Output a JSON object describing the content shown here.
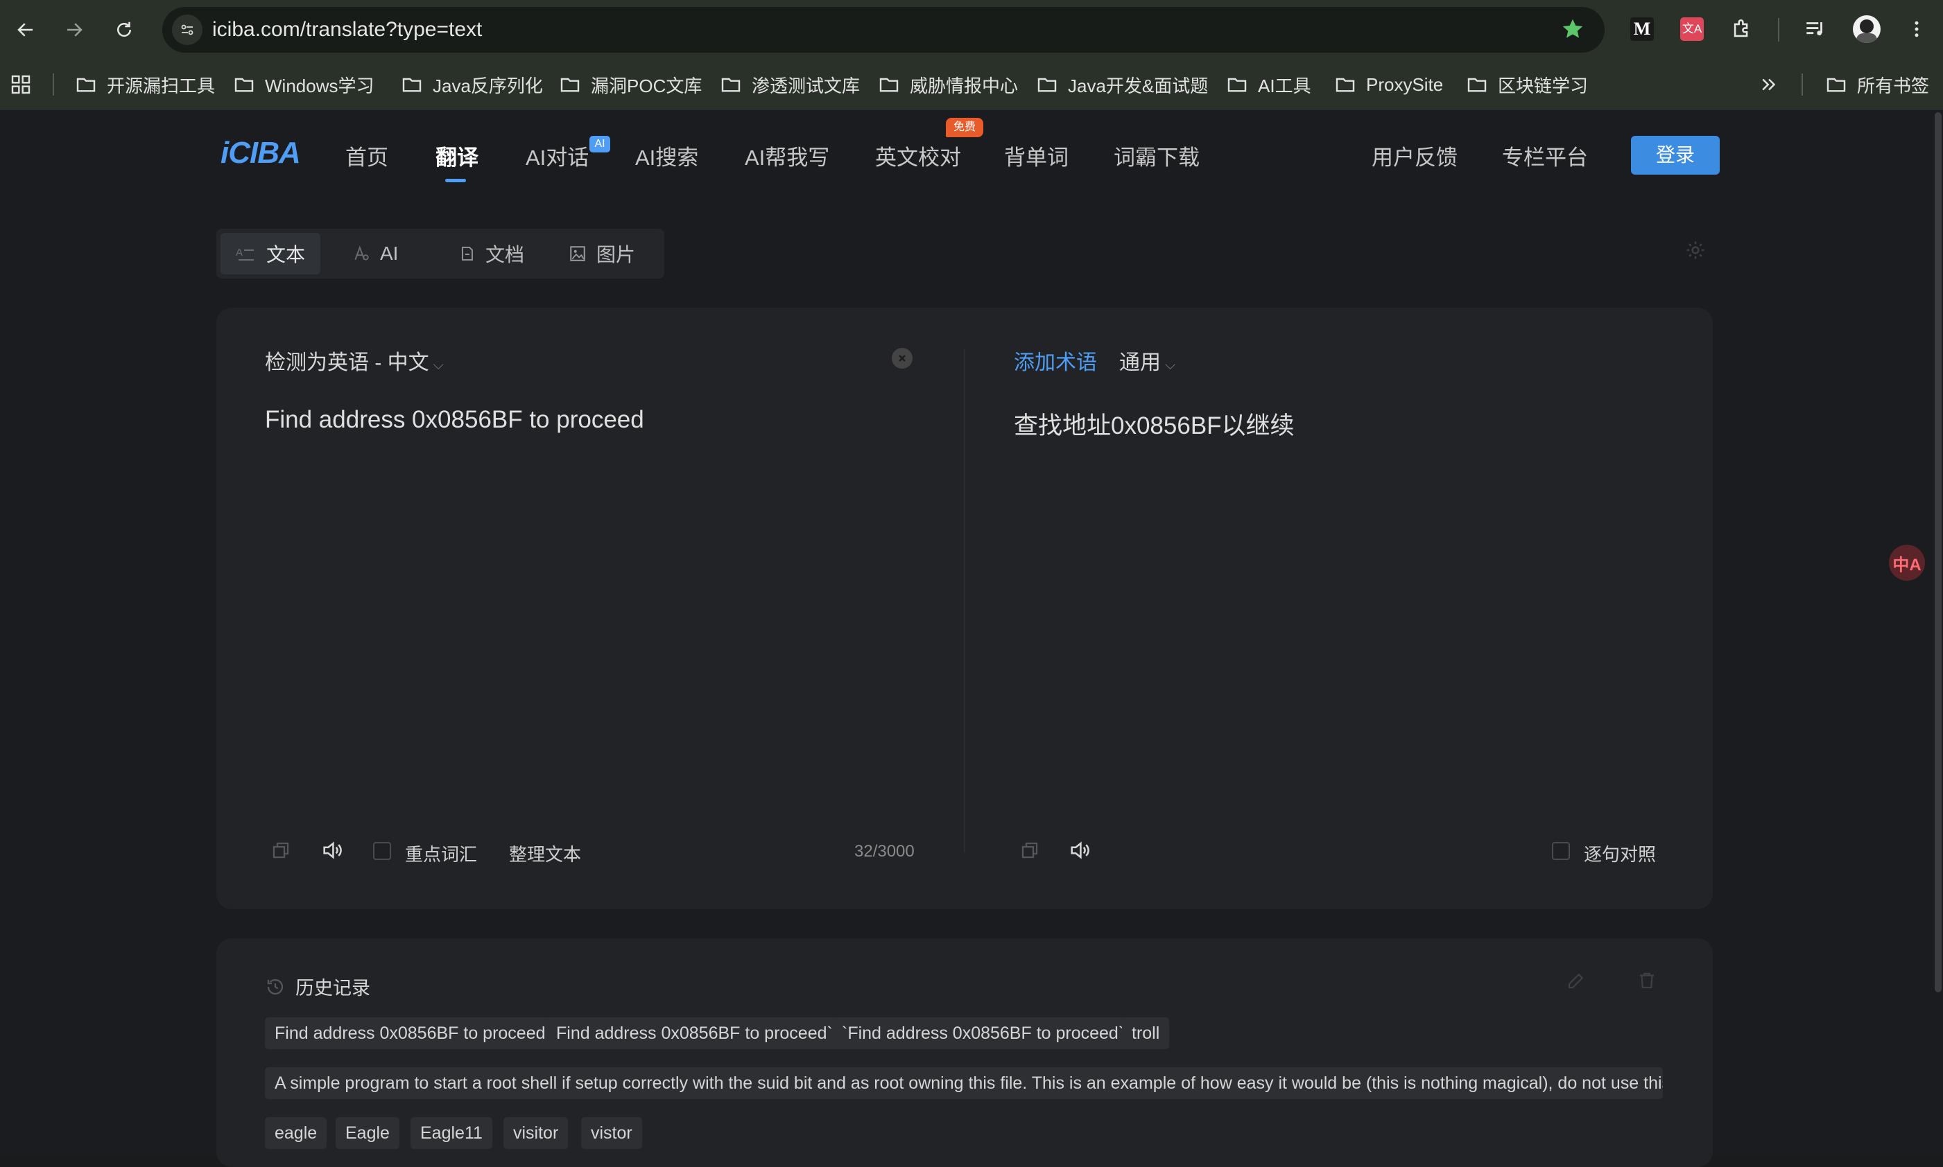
{
  "browser": {
    "url": "iciba.com/translate?type=text",
    "bookmarks": [
      "开源漏扫工具",
      "Windows学习",
      "Java反序列化",
      "漏洞POC文库",
      "渗透测试文库",
      "威胁情报中心",
      "Java开发&面试题",
      "AI工具",
      "ProxySite",
      "区块链学习"
    ],
    "all_bookmarks": "所有书签",
    "icons": [
      "back-icon",
      "forward-icon",
      "reload-icon",
      "site-info-icon",
      "star-icon",
      "m-extension-icon",
      "translate-extension-icon",
      "puzzle-icon",
      "media-icon",
      "avatar",
      "more-icon",
      "apps-icon",
      "chevron-double-right-icon",
      "folder-icon"
    ],
    "accent": "#5cc66a"
  },
  "site": {
    "logo": "iCIBA",
    "nav": [
      "首页",
      "翻译",
      "AI对话",
      "AI搜索",
      "AI帮我写",
      "英文校对",
      "背单词",
      "词霸下载"
    ],
    "nav_right": [
      "用户反馈",
      "专栏平台"
    ],
    "badge_ai": "AI",
    "badge_free": "免费",
    "login": "登录",
    "accent": "#4f9df5"
  },
  "mode_tabs": [
    "文本",
    "AI",
    "文档",
    "图片"
  ],
  "translator": {
    "detected_lang": "检测为英语 - 中文",
    "source_text": "Find address 0x0856BF to proceed",
    "add_term": "添加术语",
    "domain": "通用",
    "target_text": "查找地址0x0856BF以继续",
    "key_vocab": "重点词汇",
    "tidy_text": "整理文本",
    "char_count": "32/3000",
    "sentence_compare": "逐句对照"
  },
  "history": {
    "title": "历史记录",
    "row1": [
      "Find address 0x0856BF to proceed",
      "Find address 0x0856BF to proceed`",
      "`Find address 0x0856BF to proceed`",
      "troll"
    ],
    "row2": [
      "A simple program to start a root shell if setup correctly with the suid bit and as root owning this file. This is an example of how easy it would be (this is nothing magical), do not use this to act..."
    ],
    "row3": [
      "eagle",
      "Eagle",
      "Eagle11",
      "visitor",
      "vistor"
    ]
  },
  "floating_ext": "中A"
}
